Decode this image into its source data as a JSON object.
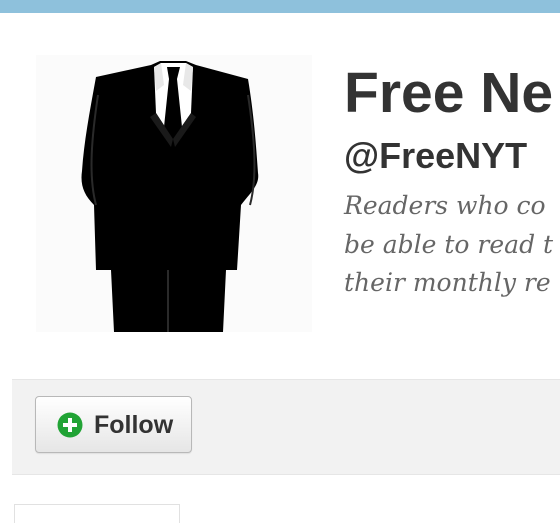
{
  "colors": {
    "top_bar": "#8ec1dc",
    "action_bar": "#f2f2f2",
    "follow_icon": "#21a335",
    "name_text": "#333333",
    "bio_text": "#666666"
  },
  "profile": {
    "avatar_icon": "suit-silhouette-icon",
    "name": "Free Ne",
    "handle": "@FreeNYT",
    "bio_lines": [
      "Readers who co",
      "be able to read t",
      "their monthly re"
    ]
  },
  "actions": {
    "follow_icon": "plus-circle-icon",
    "follow_label": "Follow"
  }
}
